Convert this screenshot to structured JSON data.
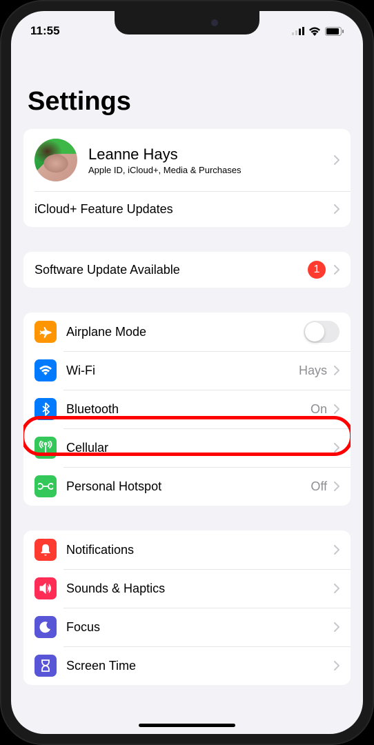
{
  "status": {
    "time": "11:55"
  },
  "page": {
    "title": "Settings"
  },
  "profile": {
    "name": "Leanne Hays",
    "subtitle": "Apple ID, iCloud+, Media & Purchases",
    "feature_updates": "iCloud+ Feature Updates"
  },
  "software_update": {
    "label": "Software Update Available",
    "badge": "1"
  },
  "connectivity": {
    "airplane": {
      "label": "Airplane Mode",
      "color": "#ff9500"
    },
    "wifi": {
      "label": "Wi-Fi",
      "detail": "Hays",
      "color": "#007aff"
    },
    "bluetooth": {
      "label": "Bluetooth",
      "detail": "On",
      "color": "#007aff"
    },
    "cellular": {
      "label": "Cellular",
      "color": "#34c759"
    },
    "hotspot": {
      "label": "Personal Hotspot",
      "detail": "Off",
      "color": "#34c759"
    }
  },
  "general": {
    "notifications": {
      "label": "Notifications",
      "color": "#ff3b30"
    },
    "sounds": {
      "label": "Sounds & Haptics",
      "color": "#ff2d55"
    },
    "focus": {
      "label": "Focus",
      "color": "#5856d6"
    },
    "screentime": {
      "label": "Screen Time",
      "color": "#5856d6"
    }
  }
}
